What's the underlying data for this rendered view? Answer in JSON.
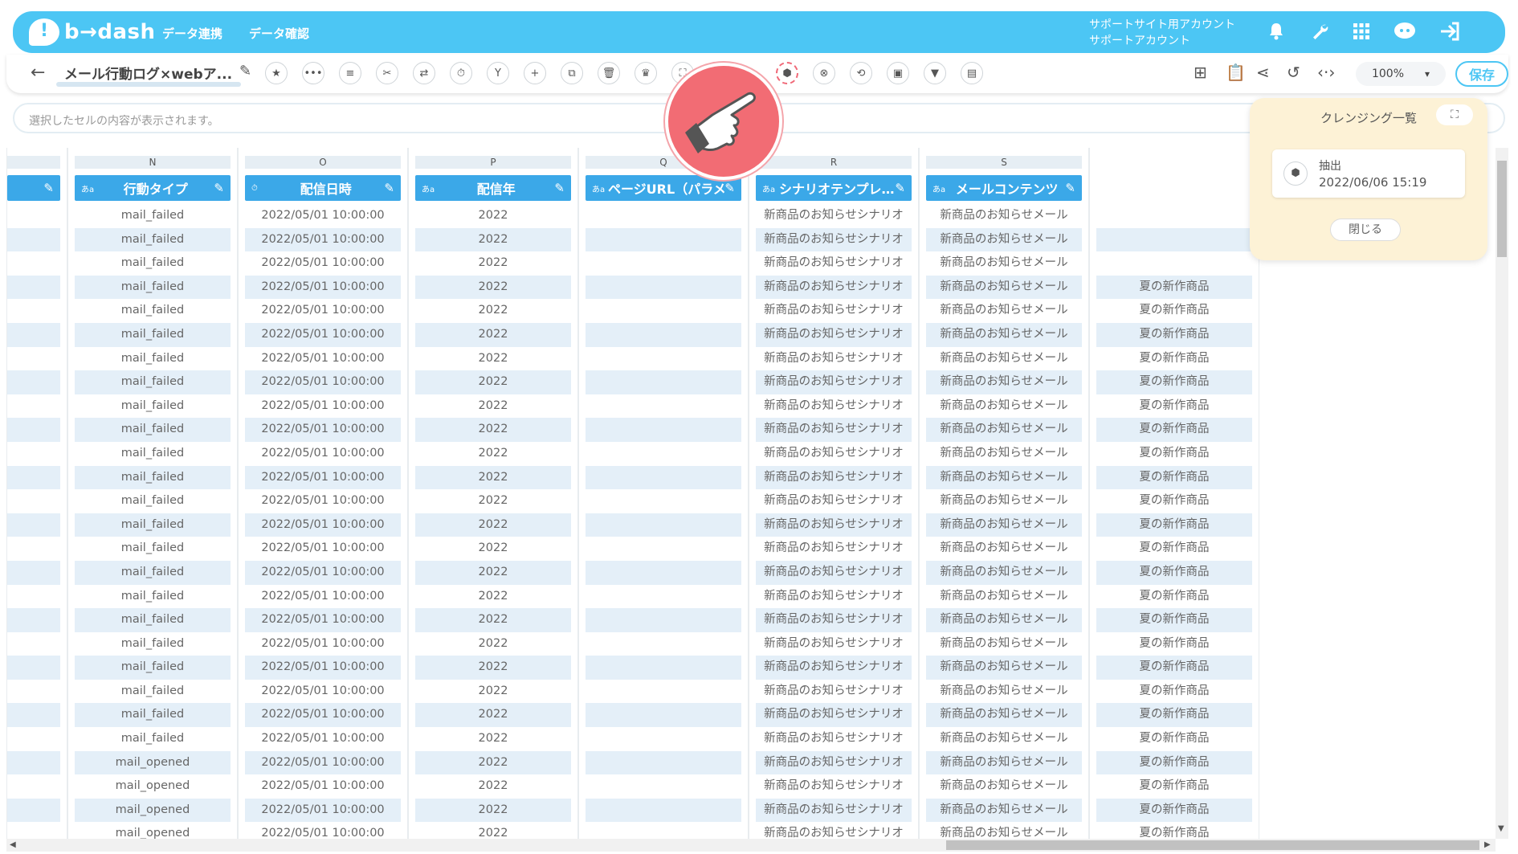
{
  "header": {
    "logo_text": "b→dash",
    "nav": [
      "データ連携",
      "データ確認"
    ],
    "account_line1": "サポートサイト用アカウント",
    "account_line2": "サポートアカウント",
    "icons": [
      "bell-icon",
      "wrench-icon",
      "apps-grid-icon",
      "support-chat-icon",
      "logout-icon"
    ]
  },
  "toolbar": {
    "title": "メール行動ログ×webア...",
    "zoom": "100%",
    "save_label": "保存",
    "tool_icons": [
      "★",
      "•••",
      "≡",
      "✂",
      "⇄",
      "⏱",
      "Y",
      "+",
      "⧉",
      "🗑",
      "♛",
      "⛶",
      "▦",
      "⬢",
      "⊗",
      "⟲",
      "▣",
      "▼",
      "▤"
    ]
  },
  "cellbar": {
    "placeholder": "選択したセルの内容が表示されます。"
  },
  "grid": {
    "columns": [
      {
        "letter": "N",
        "name": "行動タイプ",
        "type": "あa",
        "values": [
          "mail_failed",
          "mail_failed",
          "mail_failed",
          "mail_failed",
          "mail_failed",
          "mail_failed",
          "mail_failed",
          "mail_failed",
          "mail_failed",
          "mail_failed",
          "mail_failed",
          "mail_failed",
          "mail_failed",
          "mail_failed",
          "mail_failed",
          "mail_failed",
          "mail_failed",
          "mail_failed",
          "mail_failed",
          "mail_failed",
          "mail_failed",
          "mail_failed",
          "mail_failed",
          "mail_opened",
          "mail_opened",
          "mail_opened",
          "mail_opened"
        ]
      },
      {
        "letter": "O",
        "name": "配信日時",
        "type": "⏱",
        "values": [
          "2022/05/01 10:00:00",
          "2022/05/01 10:00:00",
          "2022/05/01 10:00:00",
          "2022/05/01 10:00:00",
          "2022/05/01 10:00:00",
          "2022/05/01 10:00:00",
          "2022/05/01 10:00:00",
          "2022/05/01 10:00:00",
          "2022/05/01 10:00:00",
          "2022/05/01 10:00:00",
          "2022/05/01 10:00:00",
          "2022/05/01 10:00:00",
          "2022/05/01 10:00:00",
          "2022/05/01 10:00:00",
          "2022/05/01 10:00:00",
          "2022/05/01 10:00:00",
          "2022/05/01 10:00:00",
          "2022/05/01 10:00:00",
          "2022/05/01 10:00:00",
          "2022/05/01 10:00:00",
          "2022/05/01 10:00:00",
          "2022/05/01 10:00:00",
          "2022/05/01 10:00:00",
          "2022/05/01 10:00:00",
          "2022/05/01 10:00:00",
          "2022/05/01 10:00:00",
          "2022/05/01 10:00:00"
        ]
      },
      {
        "letter": "P",
        "name": "配信年",
        "type": "あa",
        "values": [
          "2022",
          "2022",
          "2022",
          "2022",
          "2022",
          "2022",
          "2022",
          "2022",
          "2022",
          "2022",
          "2022",
          "2022",
          "2022",
          "2022",
          "2022",
          "2022",
          "2022",
          "2022",
          "2022",
          "2022",
          "2022",
          "2022",
          "2022",
          "2022",
          "2022",
          "2022",
          "2022"
        ]
      },
      {
        "letter": "Q",
        "name": "ページURL（パラメ…",
        "type": "あa",
        "values": [
          "",
          "",
          "",
          "",
          "",
          "",
          "",
          "",
          "",
          "",
          "",
          "",
          "",
          "",
          "",
          "",
          "",
          "",
          "",
          "",
          "",
          "",
          "",
          "",
          "",
          "",
          ""
        ]
      },
      {
        "letter": "R",
        "name": "シナリオテンプレ…",
        "type": "あa",
        "values": [
          "新商品のお知らせシナリオ",
          "新商品のお知らせシナリオ",
          "新商品のお知らせシナリオ",
          "新商品のお知らせシナリオ",
          "新商品のお知らせシナリオ",
          "新商品のお知らせシナリオ",
          "新商品のお知らせシナリオ",
          "新商品のお知らせシナリオ",
          "新商品のお知らせシナリオ",
          "新商品のお知らせシナリオ",
          "新商品のお知らせシナリオ",
          "新商品のお知らせシナリオ",
          "新商品のお知らせシナリオ",
          "新商品のお知らせシナリオ",
          "新商品のお知らせシナリオ",
          "新商品のお知らせシナリオ",
          "新商品のお知らせシナリオ",
          "新商品のお知らせシナリオ",
          "新商品のお知らせシナリオ",
          "新商品のお知らせシナリオ",
          "新商品のお知らせシナリオ",
          "新商品のお知らせシナリオ",
          "新商品のお知らせシナリオ",
          "新商品のお知らせシナリオ",
          "新商品のお知らせシナリオ",
          "新商品のお知らせシナリオ",
          "新商品のお知らせシナリオ"
        ]
      },
      {
        "letter": "S",
        "name": "メールコンテンツ",
        "type": "あa",
        "values": [
          "新商品のお知らせメール",
          "新商品のお知らせメール",
          "新商品のお知らせメール",
          "新商品のお知らせメール",
          "新商品のお知らせメール",
          "新商品のお知らせメール",
          "新商品のお知らせメール",
          "新商品のお知らせメール",
          "新商品のお知らせメール",
          "新商品のお知らせメール",
          "新商品のお知らせメール",
          "新商品のお知らせメール",
          "新商品のお知らせメール",
          "新商品のお知らせメール",
          "新商品のお知らせメール",
          "新商品のお知らせメール",
          "新商品のお知らせメール",
          "新商品のお知らせメール",
          "新商品のお知らせメール",
          "新商品のお知らせメール",
          "新商品のお知らせメール",
          "新商品のお知らせメール",
          "新商品のお知らせメール",
          "新商品のお知らせメール",
          "新商品のお知らせメール",
          "新商品のお知らせメール",
          "新商品のお知らせメール"
        ]
      },
      {
        "letter": "",
        "name": "",
        "type": "",
        "values": [
          "",
          "",
          "",
          "夏の新作商品",
          "夏の新作商品",
          "夏の新作商品",
          "夏の新作商品",
          "夏の新作商品",
          "夏の新作商品",
          "夏の新作商品",
          "夏の新作商品",
          "夏の新作商品",
          "夏の新作商品",
          "夏の新作商品",
          "夏の新作商品",
          "夏の新作商品",
          "夏の新作商品",
          "夏の新作商品",
          "夏の新作商品",
          "夏の新作商品",
          "夏の新作商品",
          "夏の新作商品",
          "夏の新作商品",
          "夏の新作商品",
          "夏の新作商品",
          "夏の新作商品",
          "夏の新作商品"
        ]
      }
    ]
  },
  "panel": {
    "title": "クレンジング一覧",
    "item_name": "抽出",
    "item_date": "2022/06/06 15:19",
    "close_label": "閉じる"
  }
}
